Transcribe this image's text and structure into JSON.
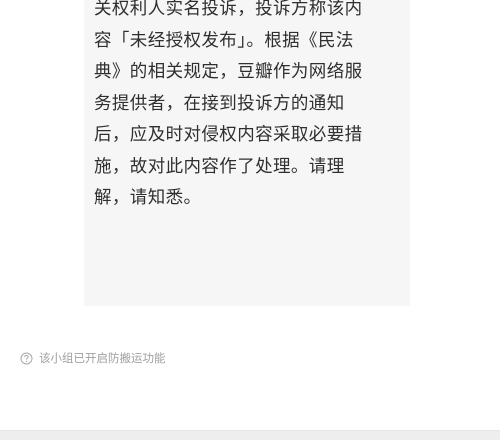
{
  "notice": {
    "lines": [
      "关权利人实名投诉，投诉方称该内",
      "容「未经授权发布」。根据《民法",
      "典》的相关规定，豆瓣作为网络服",
      "务提供者，在接到投诉方的通知",
      "后，应及时对侵权内容采取必要措",
      "施，故对此内容作了处理。请理",
      "解，请知悉。"
    ]
  },
  "footer": {
    "icon": "question-circle-icon",
    "text": "该小组已开启防搬运功能"
  },
  "colors": {
    "card_background": "#f6f6f6",
    "body_text": "#2f2f2f",
    "footer_text": "#a0a0a0",
    "page_background": "#ffffff"
  }
}
